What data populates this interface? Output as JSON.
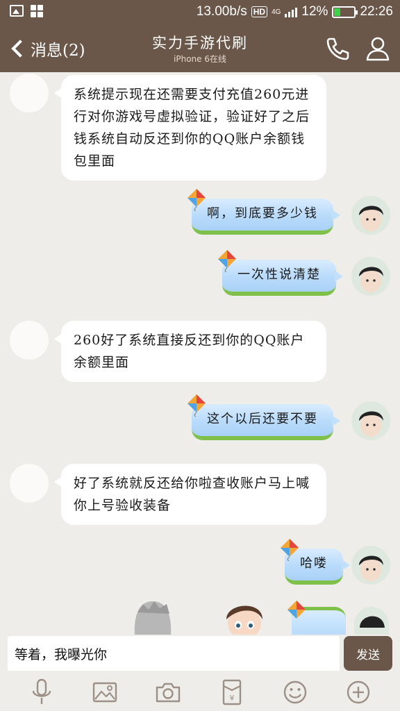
{
  "status_bar": {
    "speed": "13.00b/s",
    "hd": "HD",
    "network": "4G",
    "battery_percent": "12%",
    "battery_level": 0.12,
    "time": "22:26",
    "battery_color": "#3fd34a"
  },
  "nav": {
    "back_label": "消息(2)",
    "title": "实力手游代刷",
    "subtitle": "iPhone 6在线",
    "icons": [
      "phone-icon",
      "person-icon"
    ]
  },
  "messages": [
    {
      "side": "in",
      "text": "系统提示现在还需要支付充值260元进行对你游戏号虚拟验证，验证好了之后钱系统自动反还到你的QQ账户余额钱包里面"
    },
    {
      "side": "out",
      "text": "啊，到底要多少钱"
    },
    {
      "side": "out",
      "text": "一次性说清楚"
    },
    {
      "side": "in",
      "text": "260好了系统直接反还到你的QQ账户余额里面"
    },
    {
      "side": "out",
      "text": "这个以后还要不要"
    },
    {
      "side": "in",
      "text": "好了系统就反还给你啦查收账户马上喊你上号验收装备"
    },
    {
      "side": "out",
      "text": "哈喽"
    }
  ],
  "input": {
    "value": "等着，我曝光你",
    "send_label": "发送"
  },
  "toolbar": {
    "icons": [
      "microphone-icon",
      "image-icon",
      "camera-icon",
      "red-packet-icon",
      "emoji-icon",
      "plus-icon"
    ]
  },
  "colors": {
    "brand": "#6b5749",
    "background": "#efedea",
    "bubble_out": "#b9dbfb",
    "bubble_out_grass": "#7fc04b"
  }
}
